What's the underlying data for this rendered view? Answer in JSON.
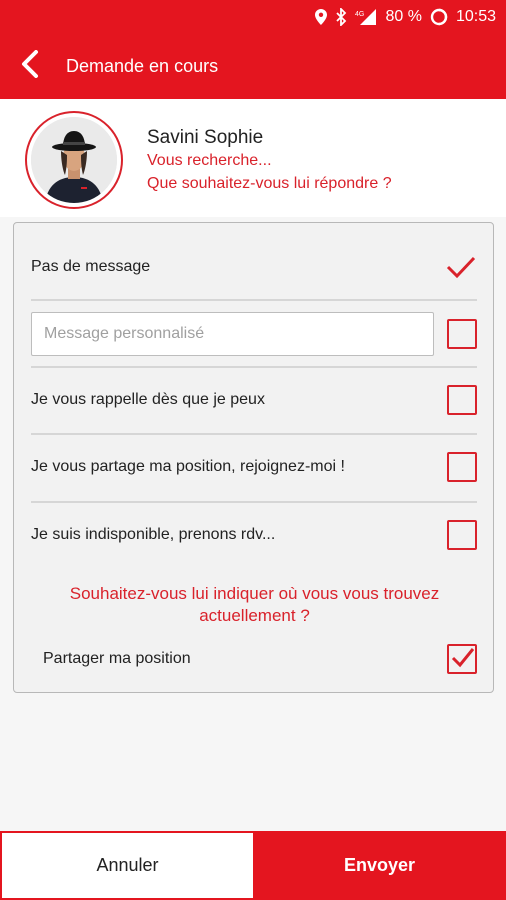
{
  "status_bar": {
    "battery": "80 %",
    "time": "10:53",
    "network": "4G",
    "icons": [
      "location-icon",
      "bluetooth-icon",
      "signal-icon",
      "battery-icon"
    ]
  },
  "app_bar": {
    "title": "Demande en cours",
    "back_icon": "chevron-left-icon"
  },
  "profile": {
    "name": "Savini Sophie",
    "line1": "Vous recherche...",
    "line2": "Que souhaitez-vous lui répondre ?"
  },
  "options": {
    "no_message": {
      "label": "Pas de message",
      "selected": true
    },
    "custom_message": {
      "placeholder": "Message personnalisé",
      "value": "",
      "checked": false
    },
    "call_back": {
      "label": "Je vous rappelle dès que je peux",
      "checked": false
    },
    "share_position": {
      "label": "Je vous partage ma position, rejoignez-moi !",
      "checked": false
    },
    "unavailable": {
      "label": "Je suis indisponible, prenons rdv...",
      "checked": false
    }
  },
  "location": {
    "question_line1": "Souhaitez-vous lui indiquer où vous vous trouvez",
    "question_line2": "actuellement ?",
    "share_label": "Partager ma position",
    "share_checked": true
  },
  "buttons": {
    "cancel": "Annuler",
    "send": "Envoyer"
  },
  "colors": {
    "accent": "#e4151f",
    "text_accent": "#d9222b"
  }
}
